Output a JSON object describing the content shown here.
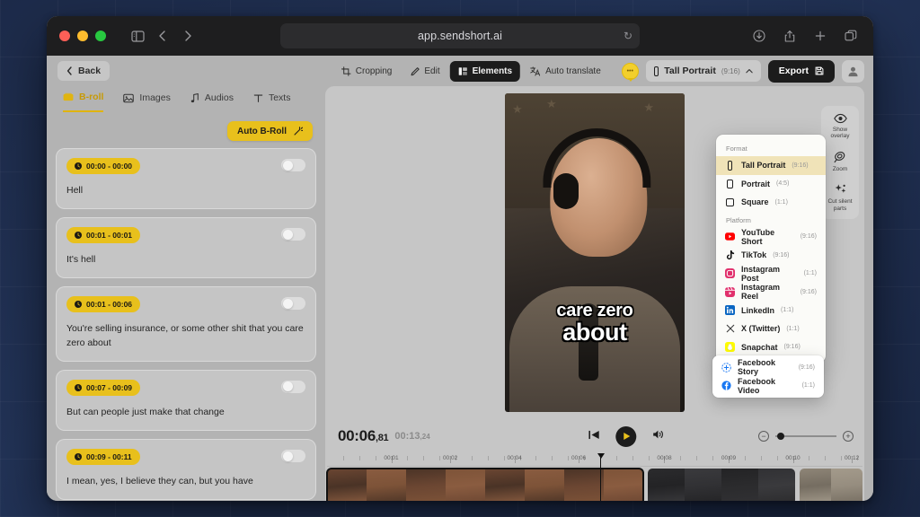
{
  "browser": {
    "url": "app.sendshort.ai",
    "reload_glyph": "↻",
    "nav": {
      "sidebar_icon": "sidebar-icon",
      "back_icon": "back-icon",
      "forward_icon": "forward-icon"
    },
    "right_icons": [
      "downloads-icon",
      "share-icon",
      "new-tab-icon",
      "tabs-icon"
    ]
  },
  "header": {
    "back_label": "Back",
    "tools": [
      {
        "label": "Cropping",
        "icon": "crop-icon",
        "active": false
      },
      {
        "label": "Edit",
        "icon": "pencil-icon",
        "active": false
      },
      {
        "label": "Elements",
        "icon": "elements-icon",
        "active": true
      },
      {
        "label": "Auto translate",
        "icon": "translate-icon",
        "active": false
      }
    ],
    "format_button": {
      "label": "Tall Portrait",
      "ratio": "(9:16)",
      "icon": "phone-portrait-icon",
      "chevron": "chevron-up-icon"
    },
    "export_label": "Export",
    "export_icon": "save-icon",
    "credits_icon": "coin-icon",
    "avatar_icon": "user-avatar-icon"
  },
  "format_dropdown": {
    "format_heading": "Format",
    "formats": [
      {
        "label": "Tall Portrait",
        "ratio": "(9:16)",
        "icon": "tall-portrait-icon",
        "selected": true
      },
      {
        "label": "Portrait",
        "ratio": "(4:5)",
        "icon": "portrait-icon",
        "selected": false
      },
      {
        "label": "Square",
        "ratio": "(1:1)",
        "icon": "square-icon",
        "selected": false
      }
    ],
    "platform_heading": "Platform",
    "platforms": [
      {
        "label": "YouTube Short",
        "ratio": "(9:16)",
        "icon": "youtube-icon",
        "color": "#ff0000"
      },
      {
        "label": "TikTok",
        "ratio": "(9:16)",
        "icon": "tiktok-icon",
        "color": "#111111"
      },
      {
        "label": "Instagram Post",
        "ratio": "(1:1)",
        "icon": "instagram-icon",
        "color": "#e1306c"
      },
      {
        "label": "Instagram Reel",
        "ratio": "(9:16)",
        "icon": "instagram-reel-icon",
        "color": "#e1306c"
      },
      {
        "label": "LinkedIn",
        "ratio": "(1:1)",
        "icon": "linkedin-icon",
        "color": "#0a66c2"
      },
      {
        "label": "X (Twitter)",
        "ratio": "(1:1)",
        "icon": "x-twitter-icon",
        "color": "#111111"
      },
      {
        "label": "Snapchat",
        "ratio": "(9:16)",
        "icon": "snapchat-icon",
        "color": "#fffc00"
      }
    ],
    "submenu": [
      {
        "label": "Facebook Story",
        "ratio": "(9:16)",
        "icon": "facebook-story-icon",
        "color": "#1877f2"
      },
      {
        "label": "Facebook Video",
        "ratio": "(1:1)",
        "icon": "facebook-icon",
        "color": "#1877f2"
      }
    ]
  },
  "sidebar": {
    "tabs": [
      {
        "label": "B-roll",
        "icon": "broll-icon",
        "active": true
      },
      {
        "label": "Images",
        "icon": "image-icon",
        "active": false
      },
      {
        "label": "Audios",
        "icon": "music-note-icon",
        "active": false
      },
      {
        "label": "Texts",
        "icon": "text-icon",
        "active": false
      }
    ],
    "auto_button": {
      "label": "Auto B-Roll",
      "icon": "magic-wand-icon"
    },
    "clips": [
      {
        "time": "00:00 - 00:00",
        "text": "Hell",
        "enabled": false
      },
      {
        "time": "00:01 - 00:01",
        "text": "It's hell",
        "enabled": false
      },
      {
        "time": "00:01 - 00:06",
        "text": "You're selling insurance, or some other shit that you care zero about",
        "enabled": false
      },
      {
        "time": "00:07 - 00:09",
        "text": "But can people just make that change",
        "enabled": false
      },
      {
        "time": "00:09 - 00:11",
        "text": "I mean, yes, I believe they can, but you have",
        "enabled": false
      }
    ]
  },
  "preview": {
    "caption_line1": "care zero",
    "caption_line2": "about",
    "rail": [
      {
        "label": "Show overlay",
        "icon": "eye-icon"
      },
      {
        "label": "Zoom",
        "icon": "magnifier-icon"
      },
      {
        "label": "Cut silent parts",
        "icon": "sparkles-icon"
      }
    ]
  },
  "player": {
    "current_time": "00:06",
    "current_ms": ",81",
    "total_time": "00:13",
    "total_ms": ",24",
    "prev_icon": "skip-back-icon",
    "play_icon": "play-icon",
    "volume_icon": "volume-icon",
    "zoom_out_label": "−",
    "zoom_in_label": "+"
  },
  "timeline": {
    "ruler_labels": [
      "00:01",
      "00:02",
      "00:04",
      "00:06",
      "00:08",
      "00:09",
      "00:10",
      "00:12"
    ],
    "ruler_positions": [
      12,
      23,
      35,
      47,
      63,
      75,
      87,
      98
    ],
    "playhead_percent": 51,
    "clips": [
      {
        "name": "main-clip",
        "selected": true,
        "flex": 60,
        "frames": 8,
        "tone": "warm"
      },
      {
        "name": "clip-2",
        "selected": false,
        "flex": 28,
        "frames": 4,
        "tone": "dark"
      },
      {
        "name": "clip-3",
        "selected": false,
        "flex": 12,
        "frames": 2,
        "tone": "light"
      }
    ]
  }
}
